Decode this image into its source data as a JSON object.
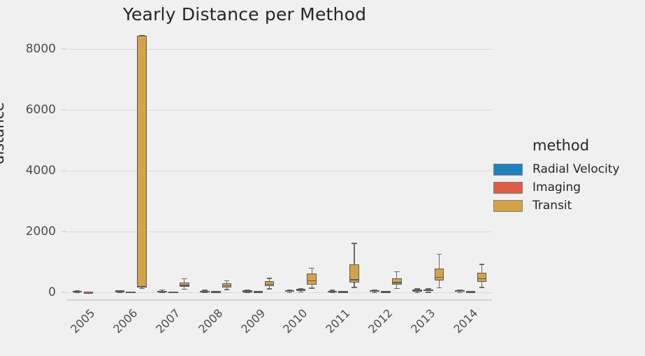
{
  "chart_data": {
    "type": "box",
    "title": "Yearly Distance per Method",
    "xlabel": "",
    "ylabel": "distance",
    "categories": [
      "2005",
      "2006",
      "2007",
      "2008",
      "2009",
      "2010",
      "2011",
      "2012",
      "2013",
      "2014"
    ],
    "ylim": [
      -250,
      8700
    ],
    "yticks": [
      0,
      2000,
      4000,
      6000,
      8000
    ],
    "ytick_labels": [
      "0",
      "2000",
      "4000",
      "6000",
      "8000"
    ],
    "grid": true,
    "legend_position": "right",
    "legend_title": "method",
    "series": [
      {
        "name": "Radial Velocity",
        "color": "#1f82bd",
        "boxes": [
          {
            "category": "2005",
            "whisker_low": 2,
            "q1": 18,
            "median": 40,
            "q3": 56,
            "whisker_high": 72
          },
          {
            "category": "2006",
            "whisker_low": 3,
            "q1": 20,
            "median": 45,
            "q3": 62,
            "whisker_high": 80
          },
          {
            "category": "2007",
            "whisker_low": 4,
            "q1": 22,
            "median": 40,
            "q3": 58,
            "whisker_high": 95
          },
          {
            "category": "2008",
            "whisker_low": 4,
            "q1": 20,
            "median": 38,
            "q3": 55,
            "whisker_high": 85
          },
          {
            "category": "2009",
            "whisker_low": 5,
            "q1": 22,
            "median": 42,
            "q3": 62,
            "whisker_high": 92
          },
          {
            "category": "2010",
            "whisker_low": 6,
            "q1": 24,
            "median": 45,
            "q3": 66,
            "whisker_high": 100
          },
          {
            "category": "2011",
            "whisker_low": 6,
            "q1": 20,
            "median": 38,
            "q3": 58,
            "whisker_high": 88
          },
          {
            "category": "2012",
            "whisker_low": 8,
            "q1": 26,
            "median": 48,
            "q3": 70,
            "whisker_high": 104
          },
          {
            "category": "2013",
            "whisker_low": 10,
            "q1": 34,
            "median": 62,
            "q3": 92,
            "whisker_high": 130
          },
          {
            "category": "2014",
            "whisker_low": 8,
            "q1": 26,
            "median": 46,
            "q3": 70,
            "whisker_high": 100
          }
        ]
      },
      {
        "name": "Imaging",
        "color": "#e05c47",
        "boxes": [
          {
            "category": "2005",
            "whisker_low": 12,
            "q1": 14,
            "median": 16,
            "q3": 18,
            "whisker_high": 20
          },
          {
            "category": "2006",
            "whisker_low": 14,
            "q1": 16,
            "median": 18,
            "q3": 21,
            "whisker_high": 24
          },
          {
            "category": "2007",
            "whisker_low": 10,
            "q1": 14,
            "median": 18,
            "q3": 24,
            "whisker_high": 30
          },
          {
            "category": "2008",
            "whisker_low": 12,
            "q1": 18,
            "median": 24,
            "q3": 32,
            "whisker_high": 42
          },
          {
            "category": "2009",
            "whisker_low": 14,
            "q1": 20,
            "median": 26,
            "q3": 34,
            "whisker_high": 46
          },
          {
            "category": "2010",
            "whisker_low": 30,
            "q1": 48,
            "median": 96,
            "q3": 128,
            "whisker_high": 150
          },
          {
            "category": "2011",
            "whisker_low": 14,
            "q1": 20,
            "median": 26,
            "q3": 34,
            "whisker_high": 44
          },
          {
            "category": "2012",
            "whisker_low": 16,
            "q1": 22,
            "median": 30,
            "q3": 40,
            "whisker_high": 52
          },
          {
            "category": "2013",
            "whisker_low": 22,
            "q1": 42,
            "median": 72,
            "q3": 104,
            "whisker_high": 132
          },
          {
            "category": "2014",
            "whisker_low": 12,
            "q1": 18,
            "median": 24,
            "q3": 32,
            "whisker_high": 42
          }
        ]
      },
      {
        "name": "Transit",
        "color": "#d4a349",
        "boxes": [
          {
            "category": "2006",
            "whisker_low": 150,
            "q1": 160,
            "median": 200,
            "q3": 8450,
            "whisker_high": 8460
          },
          {
            "category": "2007",
            "whisker_low": 120,
            "q1": 180,
            "median": 230,
            "q3": 330,
            "whisker_high": 470
          },
          {
            "category": "2008",
            "whisker_low": 110,
            "q1": 170,
            "median": 220,
            "q3": 300,
            "whisker_high": 400
          },
          {
            "category": "2009",
            "whisker_low": 130,
            "q1": 200,
            "median": 270,
            "q3": 360,
            "whisker_high": 480
          },
          {
            "category": "2010",
            "whisker_low": 160,
            "q1": 250,
            "median": 380,
            "q3": 620,
            "whisker_high": 810
          },
          {
            "category": "2011",
            "whisker_low": 180,
            "q1": 330,
            "median": 420,
            "q3": 920,
            "whisker_high": 1630
          },
          {
            "category": "2012",
            "whisker_low": 150,
            "q1": 260,
            "median": 330,
            "q3": 470,
            "whisker_high": 700
          },
          {
            "category": "2013",
            "whisker_low": 170,
            "q1": 400,
            "median": 500,
            "q3": 790,
            "whisker_high": 1270
          },
          {
            "category": "2014",
            "whisker_low": 180,
            "q1": 350,
            "median": 450,
            "q3": 650,
            "whisker_high": 940
          }
        ]
      }
    ]
  },
  "legend": {
    "title": "method",
    "entries": [
      {
        "label": "Radial Velocity",
        "color": "#1f82bd"
      },
      {
        "label": "Imaging",
        "color": "#e05c47"
      },
      {
        "label": "Transit",
        "color": "#d4a349"
      }
    ]
  }
}
